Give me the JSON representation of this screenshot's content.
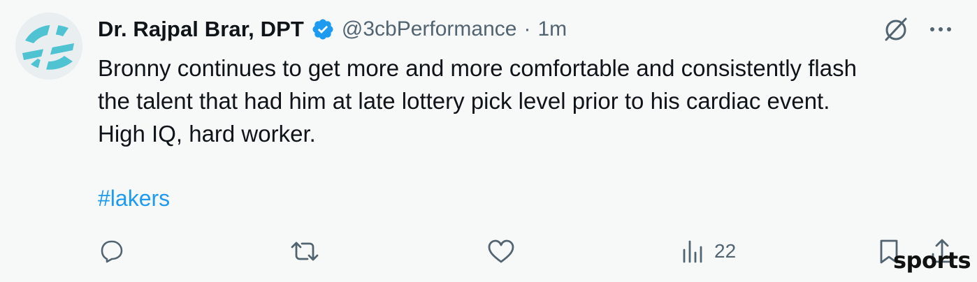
{
  "author": {
    "name": "Dr. Rajpal Brar, DPT",
    "handle": "@3cbPerformance",
    "separator": "·",
    "time": "1m"
  },
  "tweet": {
    "lines": [
      "Bronny continues to get more and more comfortable and consistently flash",
      "the talent that had him at late lottery pick level prior to his cardiac event.",
      "High IQ, hard worker."
    ],
    "hashtag": "#lakers"
  },
  "actions": {
    "views_count": "22"
  },
  "watermark": "sports",
  "colors": {
    "link": "#1d9bf0",
    "muted": "#536471",
    "text": "#0f1419",
    "avatar_teal": "#4fc3d2"
  },
  "icons": [
    "avatar-logo",
    "verified-badge-icon",
    "grok-icon",
    "more-icon",
    "reply-icon",
    "retweet-icon",
    "like-icon",
    "views-icon",
    "bookmark-icon",
    "share-icon"
  ]
}
